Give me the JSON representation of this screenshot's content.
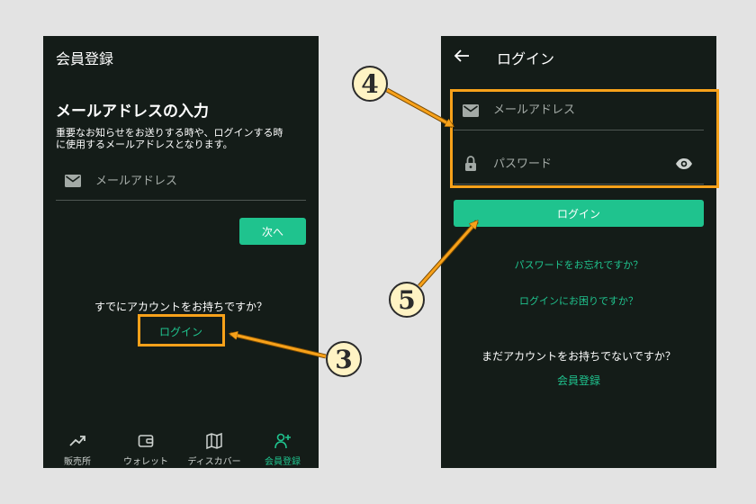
{
  "left": {
    "title": "会員登録",
    "heading": "メールアドレスの入力",
    "description_line1": "重要なお知らせをお送りする時や、ログインする時",
    "description_line2": "に使用するメールアドレスとなります。",
    "email_placeholder": "メールアドレス",
    "next_label": "次へ",
    "have_account_text": "すでにアカウントをお持ちですか？",
    "login_link": "ログイン",
    "nav": [
      {
        "label": "販売所",
        "icon": "trending-up-icon"
      },
      {
        "label": "ウォレット",
        "icon": "wallet-icon"
      },
      {
        "label": "ディスカバー",
        "icon": "map-icon"
      },
      {
        "label": "会員登録",
        "icon": "add-user-icon"
      }
    ],
    "active_nav": "会員登録"
  },
  "right": {
    "title": "ログイン",
    "email_placeholder": "メールアドレス",
    "password_placeholder": "パスワード",
    "login_button": "ログイン",
    "forgot_password": "パスワードをお忘れですか？",
    "login_trouble": "ログインにお困りですか？",
    "no_account_text": "まだアカウントをお持ちでないですか？",
    "register_link": "会員登録"
  },
  "annotations": [
    {
      "number": "3",
      "target": "login-link"
    },
    {
      "number": "4",
      "target": "credentials-fields"
    },
    {
      "number": "5",
      "target": "login-button"
    }
  ],
  "colors": {
    "background": "#141c18",
    "accent": "#1fc38e",
    "callout": "#f7a11a",
    "page": "#e3e3e3"
  }
}
